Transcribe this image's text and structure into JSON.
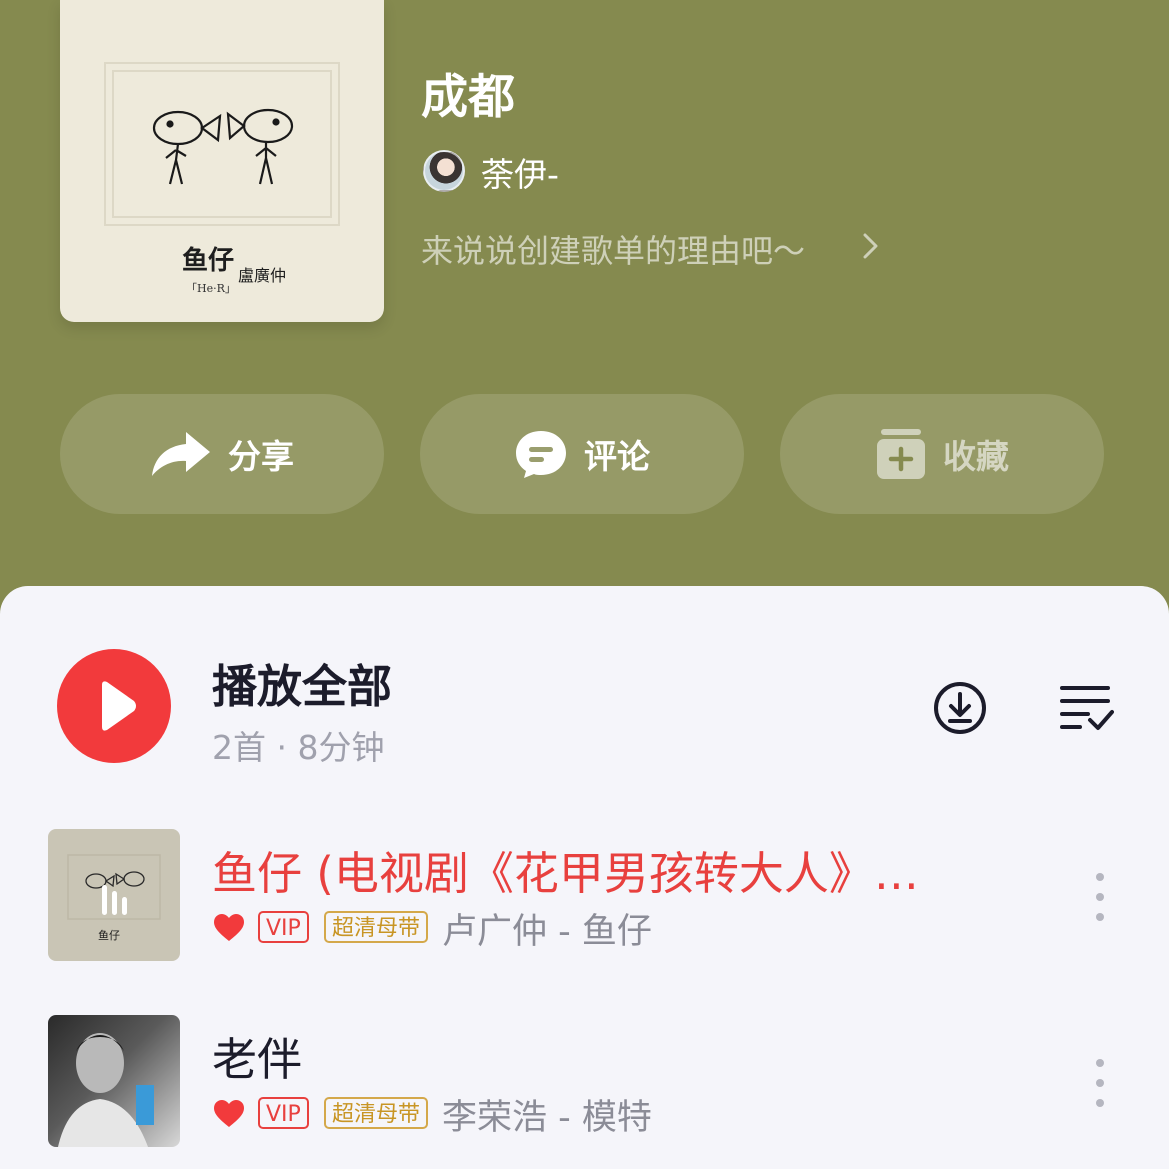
{
  "playlist": {
    "title": "成都",
    "creator": "荼伊-",
    "description": "来说说创建歌单的理由吧～",
    "cover": {
      "title_text": "鱼仔",
      "artist_text": "盧廣仲",
      "bracket_text": "「He·R」"
    }
  },
  "actions": {
    "share_label": "分享",
    "comment_label": "评论",
    "collect_label": "收藏"
  },
  "list_header": {
    "play_all_label": "播放全部",
    "meta": "2首 · 8分钟"
  },
  "songs": [
    {
      "title": "鱼仔 (电视剧《花甲男孩转大人》…",
      "artist_album": "卢广仲 - 鱼仔",
      "vip_tag": "VIP",
      "quality_tag": "超清母带",
      "playing": true,
      "liked": true
    },
    {
      "title": "老伴",
      "artist_album": "李荣浩 - 模特",
      "vip_tag": "VIP",
      "quality_tag": "超清母带",
      "playing": false,
      "liked": true
    }
  ],
  "colors": {
    "header_bg": "#858a4f",
    "accent_red": "#f23a3c",
    "vip_red": "#e8403e",
    "quality_gold": "#c89524",
    "panel_bg": "#f5f5fa"
  },
  "icons": [
    "share-icon",
    "comment-icon",
    "collect-icon",
    "play-icon",
    "download-icon",
    "multi-select-icon",
    "heart-icon",
    "more-icon",
    "chevron-right-icon",
    "playing-bars-icon"
  ]
}
